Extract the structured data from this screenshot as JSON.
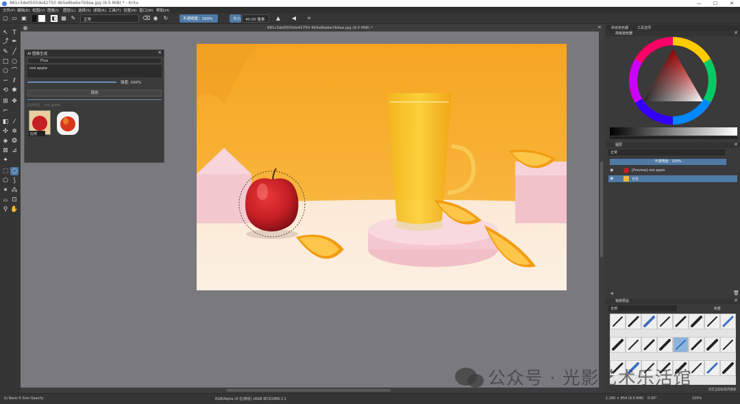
{
  "window": {
    "title": "881c3de0505de42750 4b5e8bebe7b9aa.jpg (9.5 MiB) * - Krita",
    "minimize": "—",
    "maximize": "☐",
    "close": "✕"
  },
  "menu": [
    "文件(F)",
    "编辑(E)",
    "视图(V)",
    "图像(I)",
    "图层(L)",
    "选择(S)",
    "滤镜(R)",
    "工具(T)",
    "设置(N)",
    "窗口(W)",
    "帮助(H)"
  ],
  "toolbar": {
    "blend_mode": "正常",
    "opacity_label": "不透明度：100%",
    "size_label": "大小",
    "size_value": "40.00 像素"
  },
  "document": {
    "tab_title": "881c3de0505de42750 4b5e8bebe7b9aa.jpg (9.5 MiB) *"
  },
  "ai_panel": {
    "title": "AI 图像生成",
    "model": "Flux",
    "prompt": "red apple",
    "strength_label": "强度: 100%",
    "generate_label": "填充",
    "history_label": "[100%] ...red apple",
    "apply_label": "应用",
    "count": "0"
  },
  "right_dock": {
    "tabs": [
      "高级拾色器",
      "工具选项"
    ],
    "color_panel_title": "高级拾色器",
    "layers_title": "图层",
    "layer_blend": "正常",
    "layer_opacity": "不透明度：100%",
    "layers": [
      {
        "name": "[Preview] red apple",
        "selected": false
      },
      {
        "name": "背景",
        "selected": true
      }
    ],
    "brush_title": "笔刷预设",
    "brush_filter": "全部",
    "brush_tag_label": "标签",
    "brush_search_label": "仅在当前标签内搜索",
    "brush_count": 24
  },
  "status": {
    "brush": "b) Basic-5 Size Opacity",
    "color_space": "RGB/Alpha (8 位/通道)  sRGB IEC61966-2.1",
    "dimensions": "1,280 × 854 (9.5 MiB)",
    "angle": "0.00°",
    "zoom": "100%"
  },
  "watermark": {
    "text": "公众号 · 光影艺术乐活馆"
  },
  "colors": {
    "accent": "#4f7aa6",
    "canvas_bg": "#7a797e",
    "photo_bg": "#f7a623",
    "apple": "#c51f24",
    "pink": "#f2c7cf"
  }
}
